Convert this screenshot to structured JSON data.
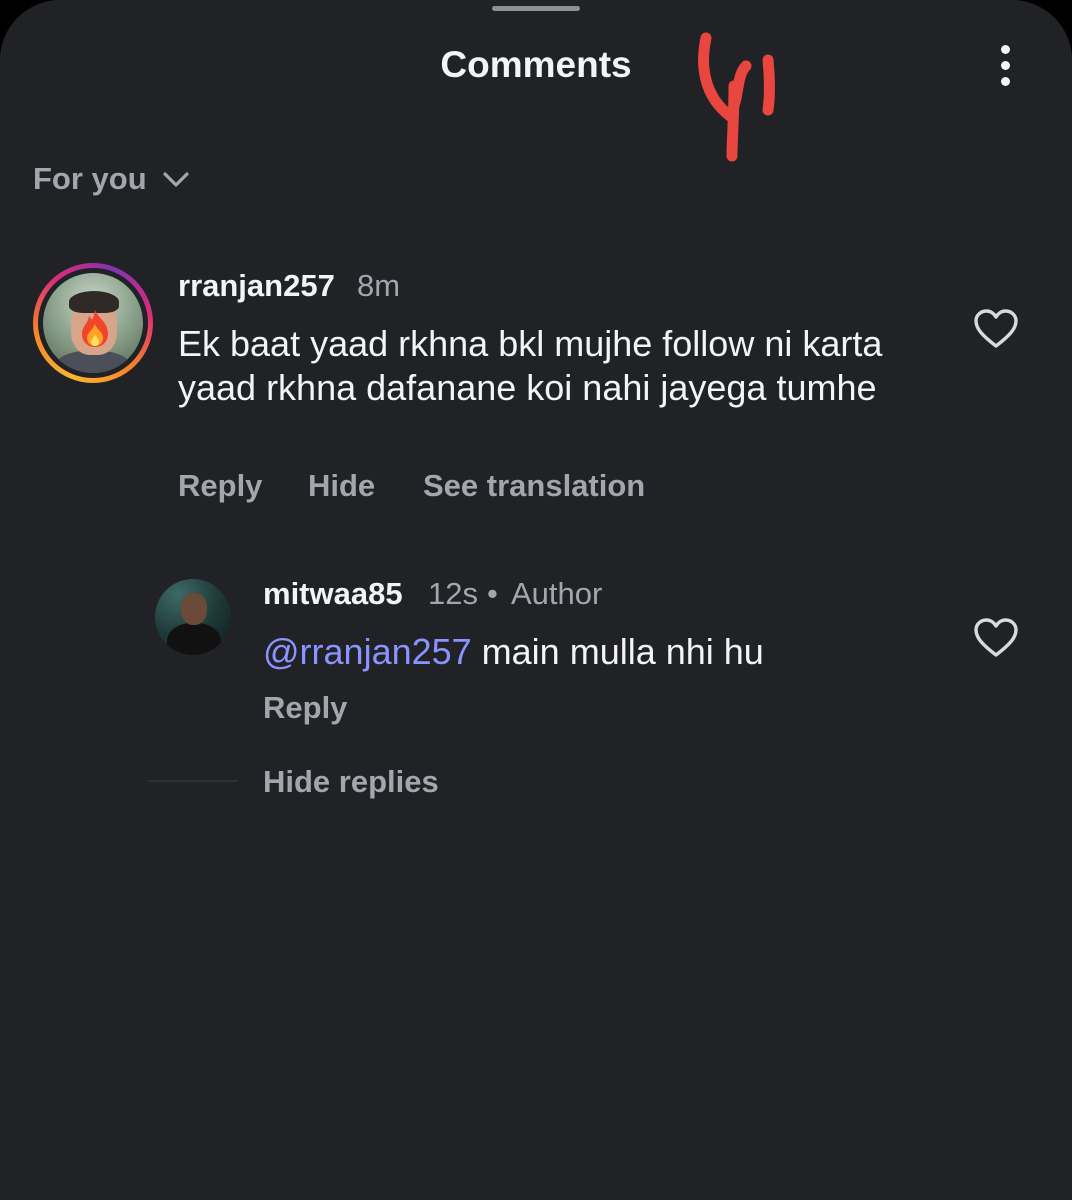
{
  "header": {
    "title": "Comments",
    "more_icon": "more-vertical-icon"
  },
  "filter": {
    "label": "For you",
    "icon": "chevron-down-icon"
  },
  "comments": [
    {
      "username": "rranjan257",
      "time": "8m",
      "text": "Ek baat yaad rkhna bkl mujhe follow ni karta yaad rkhna dafanane koi nahi jayega tumhe",
      "actions": {
        "reply": "Reply",
        "hide": "Hide",
        "translate": "See translation"
      },
      "avatar_badge": "fire-emoji-icon",
      "like_icon": "heart-outline-icon"
    }
  ],
  "replies": [
    {
      "username": "mitwaa85",
      "time": "12s",
      "separator": "•",
      "role": "Author",
      "mention": "@rranjan257",
      "text": " main mulla nhi hu",
      "actions": {
        "reply": "Reply"
      },
      "like_icon": "heart-outline-icon"
    }
  ],
  "thread": {
    "hide_replies": "Hide replies"
  },
  "colors": {
    "background": "#212226",
    "text_primary": "#f3f4f6",
    "text_secondary": "#a3a6ad",
    "mention": "#8a93ff",
    "scribble": "#e8463f"
  }
}
